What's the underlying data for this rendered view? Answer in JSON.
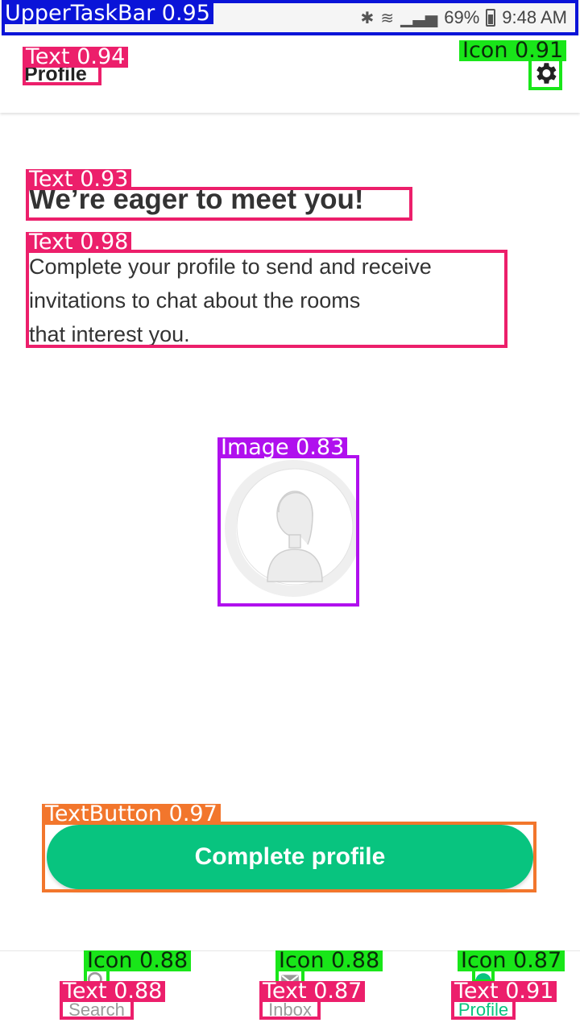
{
  "status_bar": {
    "battery": "69%",
    "time": "9:48 AM"
  },
  "header": {
    "title": "Profile",
    "settings_icon": "gear-icon"
  },
  "main": {
    "headline": "We’re eager to meet you!",
    "description_lines": [
      "Complete your profile to send and receive",
      "invitations to chat about the rooms",
      "that interest you."
    ],
    "avatar_icon": "avatar-placeholder"
  },
  "cta": {
    "label": "Complete profile"
  },
  "bottom_nav": {
    "items": [
      {
        "label": "Search",
        "icon": "search-icon",
        "active": false
      },
      {
        "label": "Inbox",
        "icon": "mail-icon",
        "active": false
      },
      {
        "label": "Profile",
        "icon": "profile-icon",
        "active": true
      }
    ]
  },
  "detections": [
    {
      "label": "UpperTaskBar",
      "score": "0.95"
    },
    {
      "label": "Text",
      "score": "0.94"
    },
    {
      "label": "Icon",
      "score": "0.91"
    },
    {
      "label": "Text",
      "score": "0.93"
    },
    {
      "label": "Text",
      "score": "0.98"
    },
    {
      "label": "Image",
      "score": "0.83"
    },
    {
      "label": "TextButton",
      "score": "0.97"
    },
    {
      "label": "Icon",
      "score": "0.88"
    },
    {
      "label": "Text",
      "score": "0.88"
    },
    {
      "label": "Icon",
      "score": "0.88"
    },
    {
      "label": "Text",
      "score": "0.87"
    },
    {
      "label": "Icon",
      "score": "0.87"
    },
    {
      "label": "Text",
      "score": "0.91"
    }
  ],
  "colors": {
    "accent": "#08c47f",
    "text_dark": "#2b2b2b",
    "nav_inactive": "#9a9a9a"
  }
}
